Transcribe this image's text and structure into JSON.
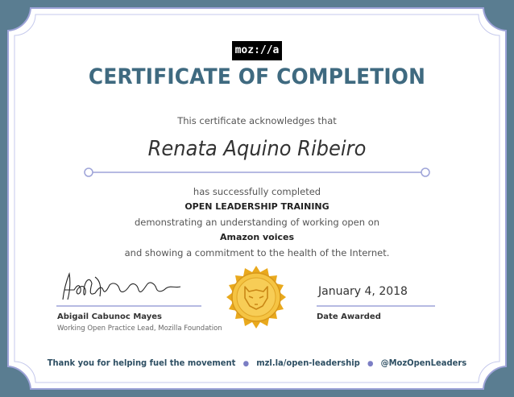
{
  "logo_text": "moz://a",
  "title": "CERTIFICATE OF COMPLETION",
  "acknowledgement": "This certificate acknowledges that",
  "recipient": "Renata Aquino Ribeiro",
  "completed_text": "has successfully completed",
  "program": "OPEN LEADERSHIP TRAINING",
  "demonstrating_text": "demonstrating an understanding of working open on",
  "project": "Amazon voices",
  "commitment_text": "and showing a commitment to the health of the Internet.",
  "signatory": {
    "name": "Abigail Cabunoc Mayes",
    "role": "Working Open Practice Lead, Mozilla Foundation"
  },
  "award": {
    "date": "January 4, 2018",
    "label": "Date Awarded"
  },
  "footer": {
    "left": "Thank you for helping fuel the movement",
    "middle": "mzl.la/open-leadership",
    "right": "@MozOpenLeaders"
  },
  "colors": {
    "background": "#5a7d91",
    "paper": "#ffffff",
    "accent": "#3f6a80",
    "ornament": "#8a8fd0",
    "seal": "#f2b632"
  }
}
